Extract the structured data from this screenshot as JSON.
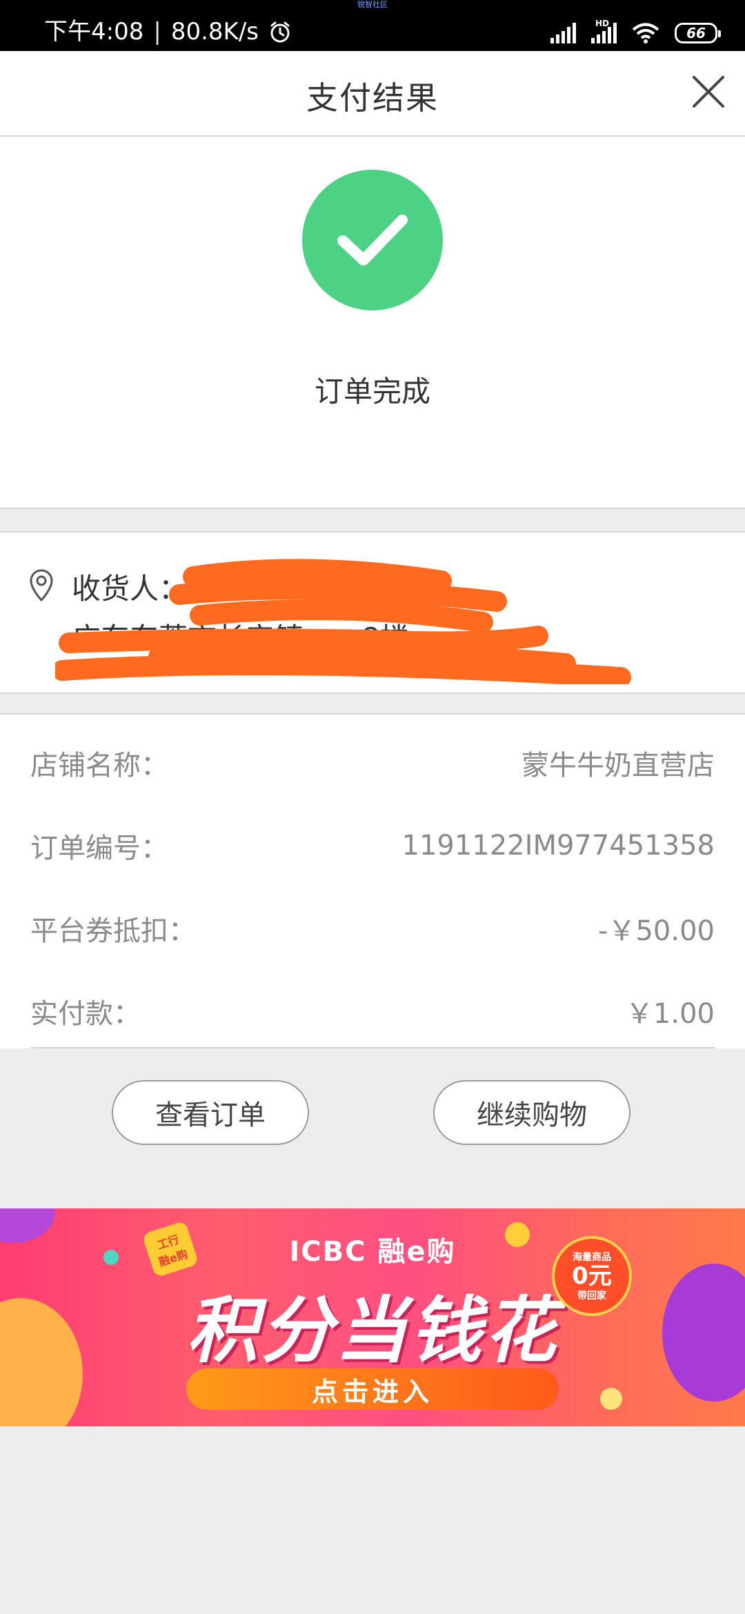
{
  "status_bar": {
    "top_label": "锐智社区",
    "time": "下午4:08",
    "separator": "|",
    "net_speed": "80.8K/s",
    "hd_label": "HD",
    "battery": "66"
  },
  "header": {
    "title": "支付结果"
  },
  "result": {
    "status_text": "订单完成"
  },
  "address": {
    "label": "收货人：",
    "line": "广东东莞市长安镇……8楼"
  },
  "order_info": [
    {
      "label": "店铺名称：",
      "value": "蒙牛牛奶直营店"
    },
    {
      "label": "订单编号：",
      "value": "1191122IM977451358"
    },
    {
      "label": "平台券抵扣：",
      "value": "-￥50.00"
    },
    {
      "label": "实付款：",
      "value": "￥1.00"
    }
  ],
  "buttons": {
    "view_order": "查看订单",
    "continue_shopping": "继续购物"
  },
  "banner": {
    "brand": "ICBC 融e购",
    "headline": "积分当钱花",
    "cta": "点击进入",
    "tag_line1": "工行",
    "tag_line2": "融e购",
    "badge_line1": "海量商品",
    "badge_line2": "0元",
    "badge_line3": "带回家"
  },
  "colors": {
    "success_green": "#4dd185",
    "redaction_orange": "#ff6a21"
  }
}
